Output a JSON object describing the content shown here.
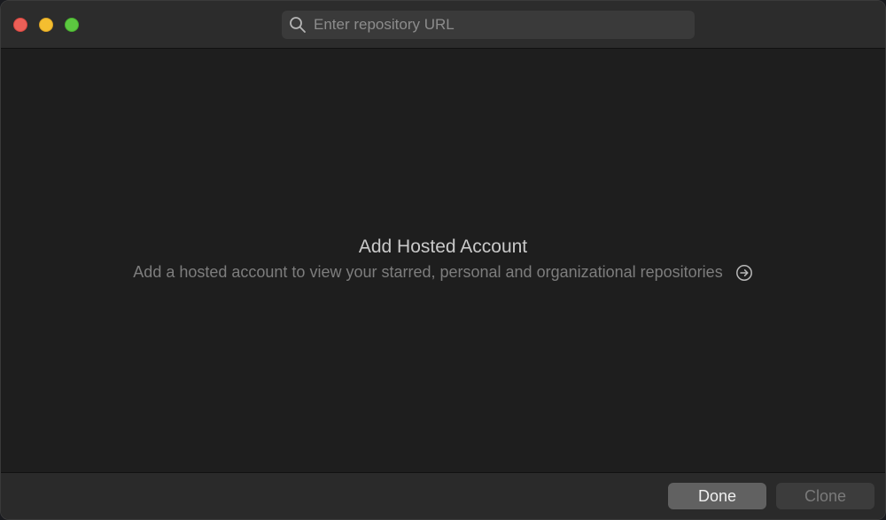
{
  "search": {
    "placeholder": "Enter repository URL",
    "value": ""
  },
  "empty_state": {
    "title": "Add Hosted Account",
    "subtitle": "Add a hosted account to view your starred, personal and organizational repositories"
  },
  "footer": {
    "done_label": "Done",
    "clone_label": "Clone"
  },
  "colors": {
    "close": "#ec5f57",
    "minimize": "#f4be30",
    "zoom": "#5cc840"
  },
  "icons": {
    "search": "search-icon",
    "arrow": "arrow-right-circle-icon"
  }
}
